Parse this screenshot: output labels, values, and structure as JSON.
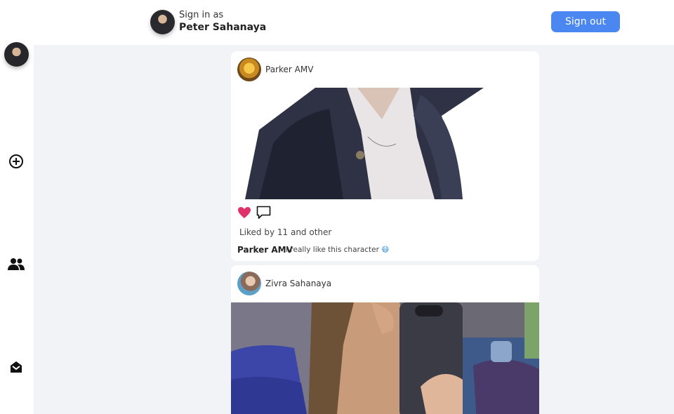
{
  "header": {
    "signin_label": "Sign in as",
    "user_name": "Peter Sahanaya",
    "signout_label": "Sign out"
  },
  "sidebar": {
    "items": [
      {
        "icon": "add-circle-icon"
      },
      {
        "icon": "friends-icon"
      },
      {
        "icon": "inbox-icon"
      }
    ]
  },
  "posts": [
    {
      "author": "Parker AMV",
      "likes_text": "Liked by 11 and other",
      "caption_author": "Parker AMV",
      "caption_text": "I really like this character",
      "caption_emoji": "😷",
      "liked": true
    },
    {
      "author": "Zivra Sahanaya"
    }
  ],
  "colors": {
    "accent": "#4a87f0",
    "like": "#e0326a",
    "background": "#f1f3f6"
  }
}
